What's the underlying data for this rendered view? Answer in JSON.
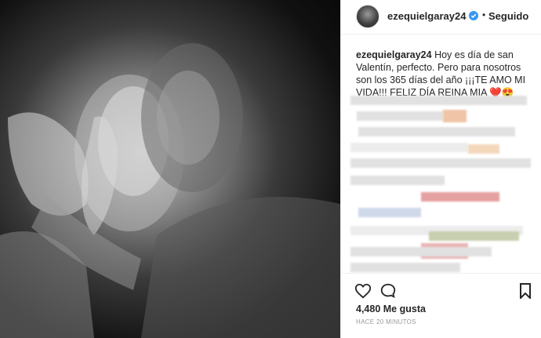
{
  "post": {
    "username": "ezequielgaray24",
    "separator": "•",
    "follow_status": "Seguido",
    "caption_user": "ezequielgaray24",
    "caption_text": " Hoy es día de san Valentín, perfecto. Pero para nosotros son los 365 días del año ¡¡¡TE AMO MI VIDA!!! FELIZ DÍA REINA MIA ❤️😍",
    "likes": "4,480 Me gusta",
    "time": "HACE 20 MINUTOS"
  },
  "icons": {
    "verified": "verified-badge-icon",
    "like": "heart-icon",
    "comment": "comment-bubble-icon",
    "save": "bookmark-icon"
  },
  "colors": {
    "verified": "#3897f0",
    "text": "#262626",
    "muted": "#999999",
    "border": "#efefef"
  }
}
